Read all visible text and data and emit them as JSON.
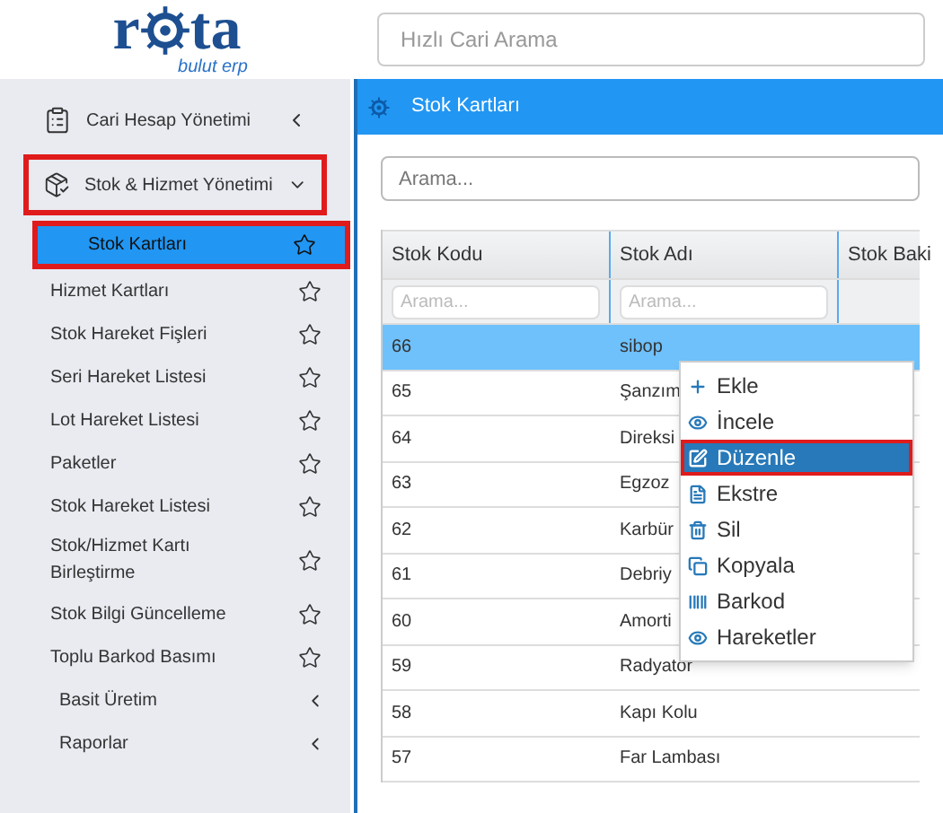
{
  "logo": {
    "before": "r",
    "after": "ta",
    "tagline": "bulut erp"
  },
  "quick_search": {
    "placeholder": "Hızlı Cari Arama"
  },
  "sidebar": {
    "sections": [
      {
        "label": "Cari Hesap Yönetimi",
        "expanded": false,
        "outlined": false
      },
      {
        "label": "Stok & Hizmet Yönetimi",
        "expanded": true,
        "outlined": true
      }
    ],
    "items": [
      {
        "kind": "link",
        "label": "Stok Kartları",
        "selected": true,
        "outlined": true
      },
      {
        "kind": "link",
        "label": "Hizmet Kartları",
        "selected": false,
        "outlined": false
      },
      {
        "kind": "link",
        "label": "Stok Hareket Fişleri",
        "selected": false,
        "outlined": false
      },
      {
        "kind": "link",
        "label": "Seri Hareket Listesi",
        "selected": false,
        "outlined": false
      },
      {
        "kind": "link",
        "label": "Lot Hareket Listesi",
        "selected": false,
        "outlined": false
      },
      {
        "kind": "link",
        "label": "Paketler",
        "selected": false,
        "outlined": false
      },
      {
        "kind": "link",
        "label": "Stok Hareket Listesi",
        "selected": false,
        "outlined": false
      },
      {
        "kind": "link",
        "label": "Stok/Hizmet Kartı Birleştirme",
        "selected": false,
        "outlined": false
      },
      {
        "kind": "link",
        "label": "Stok Bilgi Güncelleme",
        "selected": false,
        "outlined": false
      },
      {
        "kind": "link",
        "label": "Toplu Barkod Basımı",
        "selected": false,
        "outlined": false
      },
      {
        "kind": "group",
        "label": "Basit Üretim",
        "selected": false,
        "outlined": false
      },
      {
        "kind": "group",
        "label": "Raporlar",
        "selected": false,
        "outlined": false
      }
    ]
  },
  "panel": {
    "title": "Stok Kartları",
    "search": {
      "placeholder": "Arama..."
    }
  },
  "table": {
    "columns": [
      {
        "label": "Stok Kodu",
        "placeholder": "Arama..."
      },
      {
        "label": "Stok Adı",
        "placeholder": "Arama..."
      },
      {
        "label": "Stok Baki"
      }
    ],
    "rows": [
      {
        "code": "66",
        "name": "sibop",
        "selected": true
      },
      {
        "code": "65",
        "name": "Şanzım",
        "selected": false
      },
      {
        "code": "64",
        "name": "Direksi",
        "selected": false
      },
      {
        "code": "63",
        "name": "Egzoz",
        "selected": false
      },
      {
        "code": "62",
        "name": "Karbür",
        "selected": false
      },
      {
        "code": "61",
        "name": "Debriy",
        "selected": false
      },
      {
        "code": "60",
        "name": "Amorti",
        "selected": false
      },
      {
        "code": "59",
        "name": "Radyatör",
        "selected": false
      },
      {
        "code": "58",
        "name": "Kapı Kolu",
        "selected": false
      },
      {
        "code": "57",
        "name": "Far Lambası",
        "selected": false
      }
    ]
  },
  "context_menu": [
    {
      "label": "Ekle",
      "selected": false,
      "outlined": false
    },
    {
      "label": "İncele",
      "selected": false,
      "outlined": false
    },
    {
      "label": "Düzenle",
      "selected": true,
      "outlined": true
    },
    {
      "label": "Ekstre",
      "selected": false,
      "outlined": false
    },
    {
      "label": "Sil",
      "selected": false,
      "outlined": false
    },
    {
      "label": "Kopyala",
      "selected": false,
      "outlined": false
    },
    {
      "label": "Barkod",
      "selected": false,
      "outlined": false
    },
    {
      "label": "Hareketler",
      "selected": false,
      "outlined": false
    }
  ]
}
